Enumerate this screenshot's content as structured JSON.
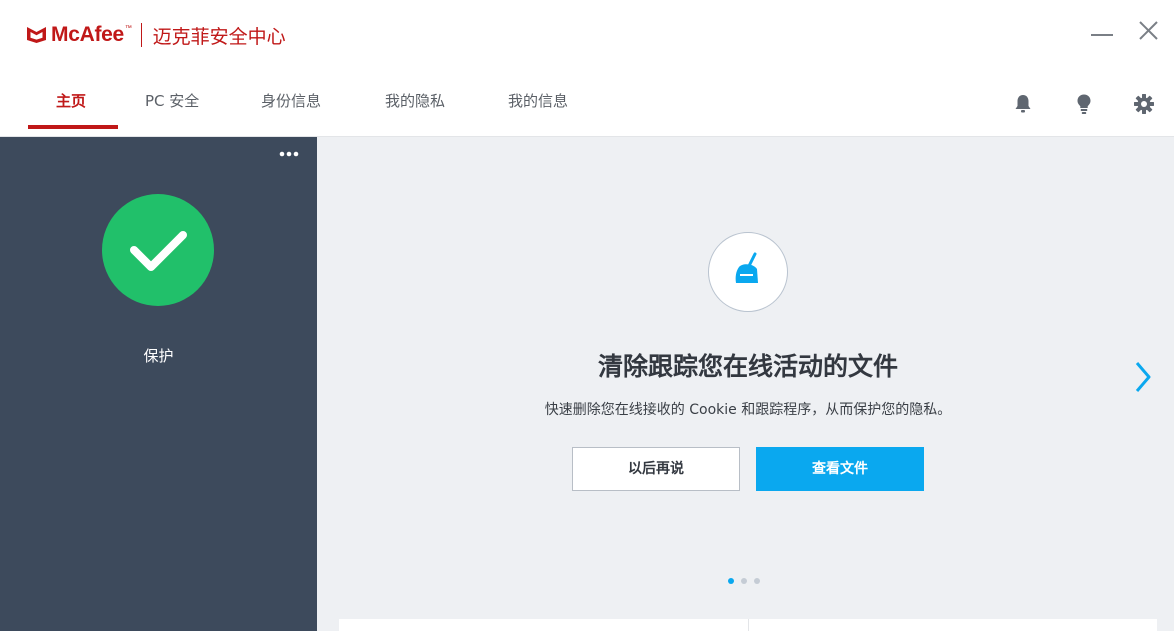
{
  "app": {
    "brand": "McAfee",
    "trademark": "™",
    "product_name": "迈克菲安全中心"
  },
  "window_controls": {
    "minimize_icon": "minimize-icon",
    "close_icon": "close-icon"
  },
  "nav": {
    "tabs": [
      {
        "label": "主页",
        "active": true
      },
      {
        "label": "PC 安全",
        "active": false
      },
      {
        "label": "身份信息",
        "active": false
      },
      {
        "label": "我的隐私",
        "active": false
      },
      {
        "label": "我的信息",
        "active": false
      }
    ],
    "icons": [
      "bell-icon",
      "lightbulb-icon",
      "gear-icon"
    ]
  },
  "sidebar": {
    "more_icon": "more-options-icon",
    "status_icon": "checkmark-icon",
    "status_label": "保护"
  },
  "feature": {
    "icon": "broom-icon",
    "title": "清除跟踪您在线活动的文件",
    "description": "快速删除您在线接收的 Cookie 和跟踪程序，从而保护您的隐私。",
    "later_button": "以后再说",
    "view_button": "查看文件",
    "next_icon": "chevron-right-icon",
    "pagination": {
      "current": 1,
      "total": 3
    }
  },
  "colors": {
    "brand_red": "#c01818",
    "sidebar_bg": "#3d4a5c",
    "status_green": "#21c06a",
    "accent_blue": "#0aa8ef",
    "main_bg": "#eef0f3"
  }
}
